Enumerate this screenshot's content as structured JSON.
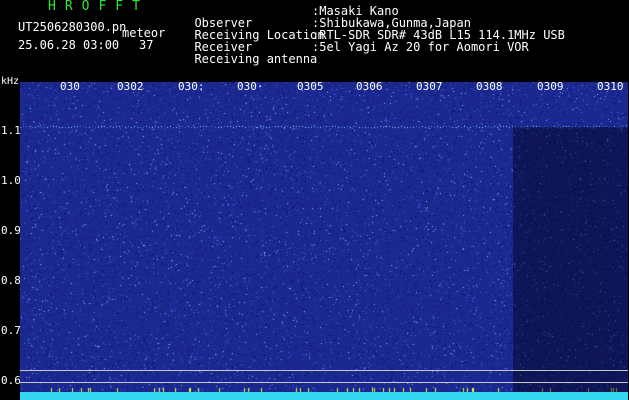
{
  "header": {
    "brand": "HROFFT",
    "filename": "UT2506280300.pn",
    "filename_suffix": "meteor",
    "datetime": "25.06.28 03:00",
    "count": "37"
  },
  "info": [
    {
      "label": "Observer",
      "value": ":Masaki Kano"
    },
    {
      "label": "Receiving Location",
      "value": ":Shibukawa,Gunma,Japan"
    },
    {
      "label": "Receiver",
      "value": ":RTL-SDR SDR# 43dB L15 114.1MHz USB"
    },
    {
      "label": "Receiving antenna",
      "value": ":5el Yagi Az 20 for Aomori VOR"
    }
  ],
  "axis": {
    "unit": "kHz",
    "y_ticks": [
      "1.1",
      "1.0",
      "0.9",
      "0.8",
      "0.7",
      "0.6"
    ],
    "time_ticks": [
      "030",
      "0302",
      "030:",
      "030·",
      "0305",
      "0306",
      "0307",
      "0308",
      "0309",
      "0310"
    ]
  },
  "colors": {
    "background": "#000000",
    "plot": "#1c2a8c",
    "accent_green": "#2ee82e",
    "bottom_bar": "#35d7ee"
  }
}
